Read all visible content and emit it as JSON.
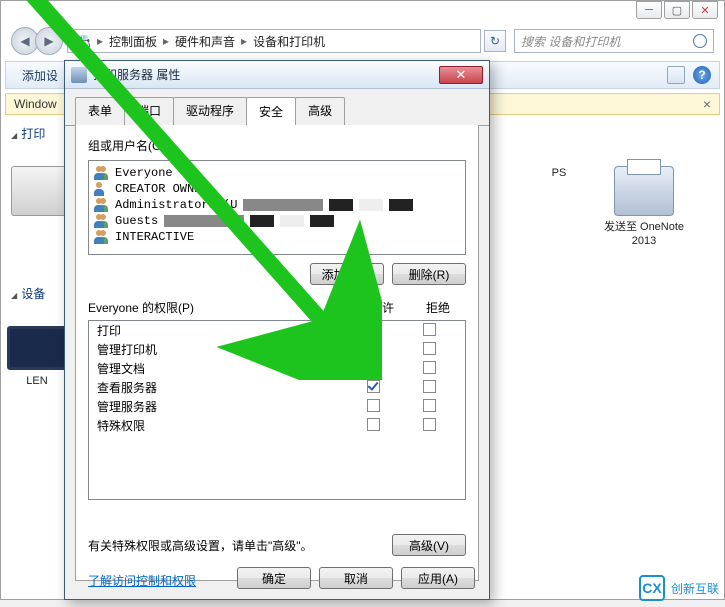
{
  "explorer": {
    "breadcrumb": {
      "seg1": "控制面板",
      "seg2": "硬件和声音",
      "seg3": "设备和打印机"
    },
    "search_placeholder": "搜索 设备和打印机",
    "toolbar": {
      "add_device": "添加设"
    },
    "notification": {
      "prefix": "Window"
    },
    "sidebar": {
      "printers": "打印",
      "devices": "设备"
    },
    "devices": {
      "onenote_ps": "PS",
      "onenote_label": "发送至 OneNote 2013",
      "len": "LEN"
    }
  },
  "dialog": {
    "title": "打印服务器 属性",
    "tabs": {
      "forms": "表单",
      "ports": "端口",
      "drivers": "驱动程序",
      "security": "安全",
      "advanced": "高级"
    },
    "group_label": "组或用户名(G):",
    "users": [
      {
        "name": "Everyone",
        "type": "multi"
      },
      {
        "name": "CREATOR OWNER",
        "type": "single",
        "partial_obscured": true
      },
      {
        "name": "Administrators (U",
        "type": "multi",
        "obscured": true
      },
      {
        "name": "Guests",
        "type": "multi",
        "obscured": true
      },
      {
        "name": "INTERACTIVE",
        "type": "multi"
      }
    ],
    "add_btn": "添加(D)...",
    "remove_btn": "删除(R)",
    "perm_label": "Everyone 的权限(P)",
    "allow_header": "允许",
    "deny_header": "拒绝",
    "permissions": [
      {
        "name": "打印",
        "allow": true,
        "deny": false,
        "highlight": false
      },
      {
        "name": "管理打印机",
        "allow": true,
        "deny": false,
        "highlight": true
      },
      {
        "name": "管理文档",
        "allow": false,
        "deny": false,
        "highlight": false
      },
      {
        "name": "查看服务器",
        "allow": true,
        "deny": false,
        "highlight": false
      },
      {
        "name": "管理服务器",
        "allow": false,
        "deny": false,
        "highlight": false
      },
      {
        "name": "特殊权限",
        "allow": false,
        "deny": false,
        "highlight": false
      }
    ],
    "footer_text": "有关特殊权限或高级设置，请单击\"高级\"。",
    "advanced_btn": "高级(V)",
    "help_link": "了解访问控制和权限",
    "ok_btn": "确定",
    "cancel_btn": "取消",
    "apply_btn": "应用(A)"
  },
  "watermark": {
    "icon": "CX",
    "text": "创新互联"
  }
}
